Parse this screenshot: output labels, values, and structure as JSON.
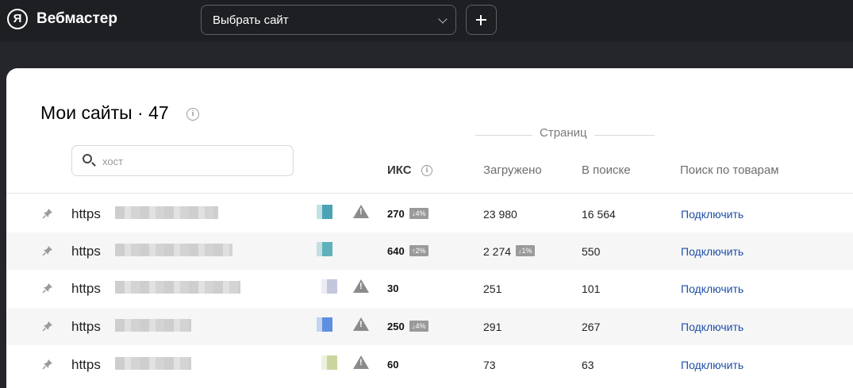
{
  "header": {
    "logo_letter": "Я",
    "brand": "Вебмастер",
    "site_select": "Выбрать сайт",
    "add_button": "+"
  },
  "page": {
    "title": "Мои сайты · 47",
    "search_placeholder": "хост"
  },
  "columns": {
    "group": "Страниц",
    "iks": "ИКС",
    "loaded": "Загружено",
    "in_search": "В поиске",
    "products": "Поиск по товарам"
  },
  "rows": [
    {
      "host": "https",
      "iks": "270",
      "iks_badge": "↓4%",
      "loaded": "23 980",
      "loaded_badge": "",
      "in_search": "16 564",
      "action": "Подключить",
      "warning": true,
      "favicon_color": "#4aa3b5"
    },
    {
      "host": "https",
      "iks": "640",
      "iks_badge": "↑2%",
      "loaded": "2 274",
      "loaded_badge": "↓1%",
      "in_search": "550",
      "action": "Подключить",
      "warning": false,
      "favicon_color": "#5fb0bb"
    },
    {
      "host": "https",
      "iks": "30",
      "iks_badge": "",
      "loaded": "251",
      "loaded_badge": "",
      "in_search": "101",
      "action": "Подключить",
      "warning": true,
      "favicon_color": "#c3c6dd"
    },
    {
      "host": "https",
      "iks": "250",
      "iks_badge": "↓4%",
      "loaded": "291",
      "loaded_badge": "",
      "in_search": "267",
      "action": "Подключить",
      "warning": true,
      "favicon_color": "#5e8fe0"
    },
    {
      "host": "https",
      "iks": "60",
      "iks_badge": "",
      "loaded": "73",
      "loaded_badge": "",
      "in_search": "63",
      "action": "Подключить",
      "warning": true,
      "favicon_color": "#c8d69e"
    }
  ]
}
